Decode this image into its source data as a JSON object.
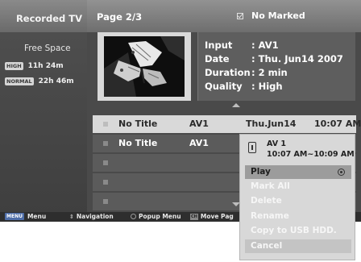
{
  "sidebar": {
    "title": "Recorded TV",
    "free_space_label": "Free Space",
    "quality_rows": [
      {
        "badge": "HIGH",
        "value": "11h 24m"
      },
      {
        "badge": "NORMAL",
        "value": "22h 46m"
      }
    ]
  },
  "header": {
    "page": "Page 2/3",
    "marked_label": "No Marked"
  },
  "info": {
    "input_label": "Input",
    "input_value": ": AV1",
    "date_label": "Date",
    "date_value": ": Thu. Jun14 2007",
    "duration_label": "Duration",
    "duration_value": ": 2 min",
    "quality_label": "Quality",
    "quality_value": ": High"
  },
  "list": {
    "rows": [
      {
        "title": "No Title",
        "input": "AV1",
        "date": "Thu.Jun14",
        "time": "10:07 AM"
      },
      {
        "title": "No Title",
        "input": "AV1",
        "date": "",
        "time": ""
      }
    ]
  },
  "bottom_bar": {
    "menu_key": "MENU",
    "menu_label": "Menu",
    "navigation_label": "Navigation",
    "popup_label": "Popup Menu",
    "ch_key": "CH",
    "move_label": "Move Pag"
  },
  "popup": {
    "channel": "AV 1",
    "time": "10:07 AM~10:09 AM",
    "items": [
      "Play",
      "Mark All",
      "Delete",
      "Rename",
      "Copy to USB HDD.",
      "Cancel"
    ]
  },
  "colors": {
    "screen_bg": "#4a4a4a",
    "highlight_row": "#d9d9d9",
    "menu_key": "#4f6ea8"
  }
}
